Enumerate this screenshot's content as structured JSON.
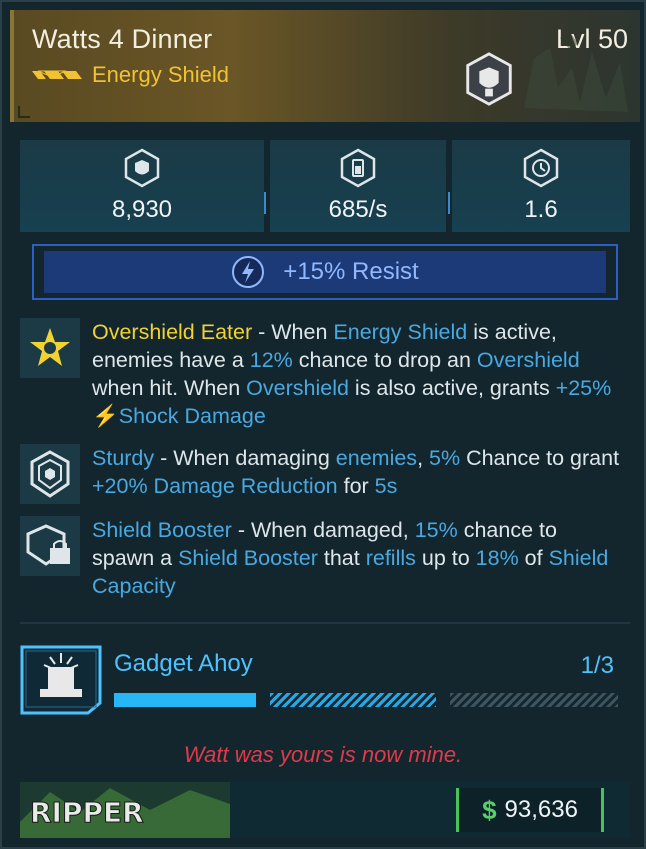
{
  "item": {
    "name": "Watts 4 Dinner",
    "level": "Lvl 50",
    "type": "Energy Shield",
    "rarity_color": "#f1c232"
  },
  "stats": [
    {
      "icon": "shield-capacity-icon",
      "value": "8,930"
    },
    {
      "icon": "recharge-rate-icon",
      "value": "685/s"
    },
    {
      "icon": "recharge-delay-icon",
      "value": "1.6"
    }
  ],
  "resist": {
    "icon": "shock-icon",
    "text": "+15% Resist"
  },
  "perks": [
    {
      "icon": "overshield-eater-icon",
      "segments": [
        {
          "t": "Overshield Eater",
          "c": "name"
        },
        {
          "t": " - When ",
          "c": ""
        },
        {
          "t": "Energy Shield",
          "c": "hl"
        },
        {
          "t": " is active, enemies have a ",
          "c": ""
        },
        {
          "t": "12%",
          "c": "hl"
        },
        {
          "t": " chance to drop an ",
          "c": ""
        },
        {
          "t": "Overshield",
          "c": "hl"
        },
        {
          "t": " when hit. When ",
          "c": ""
        },
        {
          "t": "Overshield",
          "c": "hl"
        },
        {
          "t": " is also active, grants ",
          "c": ""
        },
        {
          "t": "+25% ",
          "c": "hl"
        },
        {
          "t": "⚡",
          "c": "hl"
        },
        {
          "t": "Shock Damage",
          "c": "hl"
        }
      ]
    },
    {
      "icon": "sturdy-icon",
      "segments": [
        {
          "t": "Sturdy",
          "c": "hl"
        },
        {
          "t": " - When damaging ",
          "c": ""
        },
        {
          "t": "enemies",
          "c": "hl"
        },
        {
          "t": ", ",
          "c": ""
        },
        {
          "t": "5%",
          "c": "hl"
        },
        {
          "t": " Chance to grant ",
          "c": ""
        },
        {
          "t": "+20% Damage Reduction",
          "c": "hl"
        },
        {
          "t": " for ",
          "c": ""
        },
        {
          "t": "5s",
          "c": "hl"
        }
      ]
    },
    {
      "icon": "shield-booster-icon",
      "segments": [
        {
          "t": "Shield Booster",
          "c": "hl"
        },
        {
          "t": " - When damaged, ",
          "c": ""
        },
        {
          "t": "15%",
          "c": "hl"
        },
        {
          "t": " chance to spawn a ",
          "c": ""
        },
        {
          "t": "Shield Booster",
          "c": "hl"
        },
        {
          "t": " that ",
          "c": ""
        },
        {
          "t": "refills",
          "c": "hl"
        },
        {
          "t": " up to ",
          "c": ""
        },
        {
          "t": "18%",
          "c": "hl"
        },
        {
          "t": " of ",
          "c": ""
        },
        {
          "t": "Shield Capacity",
          "c": "hl"
        }
      ]
    }
  ],
  "challenge": {
    "icon": "gadget-ahoy-icon",
    "name": "Gadget Ahoy",
    "count": "1/3",
    "progress": 0.333
  },
  "flavor_text": "Watt was yours is now mine.",
  "manufacturer": {
    "name": "Ripper",
    "logo_text": "RIPPER"
  },
  "price": {
    "currency_symbol": "$",
    "value": "93,636"
  },
  "colors": {
    "highlight": "#4aa8e0",
    "perk_name": "#f1d232",
    "flavor": "#e03a4a",
    "money": "#5ad06a",
    "gadget": "#4ec2ff"
  }
}
